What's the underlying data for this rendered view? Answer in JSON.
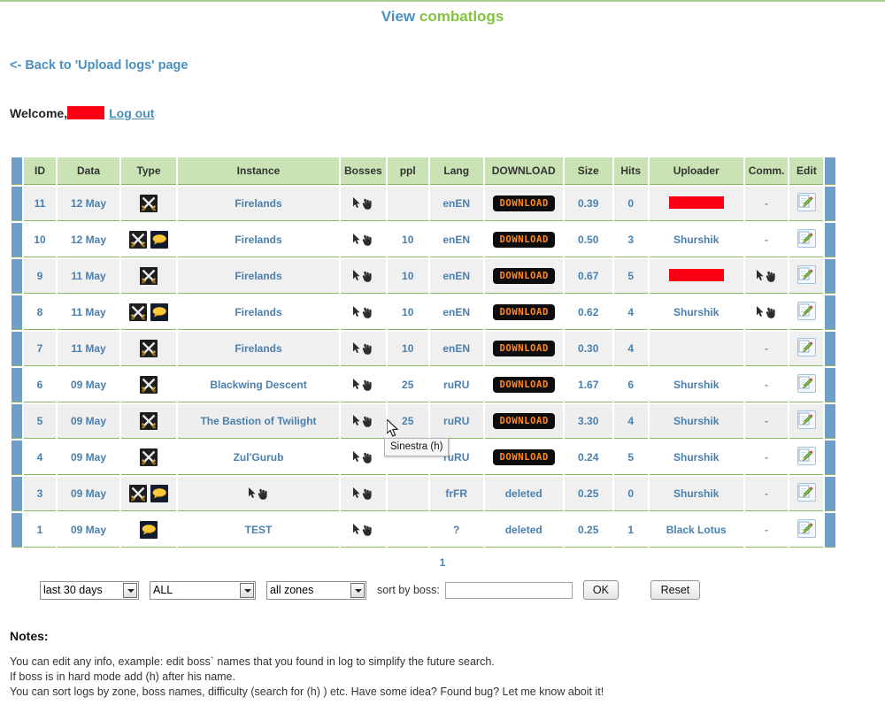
{
  "header": {
    "title_part1": "View",
    "title_part2": "combatlogs",
    "back_link": "<- Back to 'Upload logs' page",
    "welcome_label": "Welcome,",
    "logout_label": "Log out"
  },
  "table": {
    "columns": [
      "ID",
      "Data",
      "Type",
      "Instance",
      "Bosses",
      "ppl",
      "Lang",
      "DOWNLOAD",
      "Size",
      "Hits",
      "Uploader",
      "Comm.",
      "Edit"
    ],
    "rows": [
      {
        "id": "11",
        "data": "12 May",
        "type": [
          "swords"
        ],
        "instance": "Firelands",
        "bosses": "cursor",
        "ppl": "",
        "lang": "enEN",
        "download": "DOWNLOAD",
        "download_kind": "button",
        "size": "0.39",
        "hits": "0",
        "uploader": "",
        "uploader_redacted": true,
        "comm": "-",
        "edit": "edit-icon"
      },
      {
        "id": "10",
        "data": "12 May",
        "type": [
          "swords",
          "chat"
        ],
        "instance": "Firelands",
        "bosses": "cursor",
        "ppl": "10",
        "lang": "enEN",
        "download": "DOWNLOAD",
        "download_kind": "button",
        "size": "0.50",
        "hits": "3",
        "uploader": "Shurshik",
        "uploader_redacted": false,
        "comm": "-",
        "edit": "edit-icon"
      },
      {
        "id": "9",
        "data": "11 May",
        "type": [
          "swords"
        ],
        "instance": "Firelands",
        "bosses": "cursor",
        "ppl": "10",
        "lang": "enEN",
        "download": "DOWNLOAD",
        "download_kind": "button",
        "size": "0.67",
        "hits": "5",
        "uploader": "",
        "uploader_redacted": true,
        "comm": "cursor",
        "edit": "edit-icon"
      },
      {
        "id": "8",
        "data": "11 May",
        "type": [
          "swords",
          "chat"
        ],
        "instance": "Firelands",
        "bosses": "cursor",
        "ppl": "10",
        "lang": "enEN",
        "download": "DOWNLOAD",
        "download_kind": "button",
        "size": "0.62",
        "hits": "4",
        "uploader": "Shurshik",
        "uploader_redacted": false,
        "comm": "cursor",
        "edit": "edit-icon"
      },
      {
        "id": "7",
        "data": "11 May",
        "type": [
          "swords"
        ],
        "instance": "Firelands",
        "bosses": "cursor",
        "ppl": "10",
        "lang": "enEN",
        "download": "DOWNLOAD",
        "download_kind": "button",
        "size": "0.30",
        "hits": "4",
        "uploader": "",
        "uploader_redacted": false,
        "comm": "-",
        "edit": "edit-icon"
      },
      {
        "id": "6",
        "data": "09 May",
        "type": [
          "swords"
        ],
        "instance": "Blackwing Descent",
        "bosses": "cursor",
        "ppl": "25",
        "lang": "ruRU",
        "download": "DOWNLOAD",
        "download_kind": "button",
        "size": "1.67",
        "hits": "6",
        "uploader": "Shurshik",
        "uploader_redacted": false,
        "comm": "-",
        "edit": "edit-icon"
      },
      {
        "id": "5",
        "data": "09 May",
        "type": [
          "swords"
        ],
        "instance": "The Bastion of Twilight",
        "bosses": "cursor",
        "ppl": "25",
        "lang": "ruRU",
        "download": "DOWNLOAD",
        "download_kind": "button",
        "size": "3.30",
        "hits": "4",
        "uploader": "Shurshik",
        "uploader_redacted": false,
        "comm": "-",
        "edit": "edit-icon",
        "hovered": true
      },
      {
        "id": "4",
        "data": "09 May",
        "type": [
          "swords"
        ],
        "instance": "Zul'Gurub",
        "bosses": "cursor",
        "ppl": "",
        "lang": "ruRU",
        "download": "DOWNLOAD",
        "download_kind": "button",
        "size": "0.24",
        "hits": "5",
        "uploader": "Shurshik",
        "uploader_redacted": false,
        "comm": "-",
        "edit": "edit-icon"
      },
      {
        "id": "3",
        "data": "09 May",
        "type": [
          "swords",
          "chat"
        ],
        "instance": "cursor",
        "bosses": "cursor",
        "ppl": "",
        "lang": "frFR",
        "download": "deleted",
        "download_kind": "text",
        "size": "0.25",
        "hits": "0",
        "uploader": "Shurshik",
        "uploader_redacted": false,
        "comm": "-",
        "edit": "edit-icon"
      },
      {
        "id": "1",
        "data": "09 May",
        "type": [
          "chat"
        ],
        "instance": "TEST",
        "bosses": "cursor",
        "ppl": "",
        "lang": "?",
        "download": "deleted",
        "download_kind": "text",
        "size": "0.25",
        "hits": "1",
        "uploader": "Black Lotus",
        "uploader_redacted": false,
        "comm": "-",
        "edit": "edit-icon"
      }
    ]
  },
  "tooltip": {
    "text": "Sinestra (h)"
  },
  "pager": {
    "current_page": "1"
  },
  "filters": {
    "period": {
      "value": "last 30 days",
      "options": [
        "last 30 days"
      ]
    },
    "type": {
      "value": "ALL",
      "options": [
        "ALL"
      ]
    },
    "zone": {
      "value": "all zones",
      "options": [
        "all zones"
      ]
    },
    "sort_label": "sort by boss:",
    "sort_value": "",
    "sort_placeholder": "",
    "ok_label": "OK",
    "reset_label": "Reset"
  },
  "notes": {
    "title": "Notes:",
    "line1": "You can edit any info, example: edit boss` names that you found in log to simplify the future search.",
    "line2": "If boss is in hard mode add (h) after his name.",
    "line3": "You can sort logs by zone, boss names, difficulty (search for (h) ) etc. Have some idea? Found bug? Let me know aboit it!"
  },
  "colors": {
    "accent_blue": "#4a8fc0",
    "accent_green": "#84c341",
    "header_bg": "#c9e3b4",
    "redaction": "#fb0014",
    "download_orange": "#ff8a1e"
  }
}
